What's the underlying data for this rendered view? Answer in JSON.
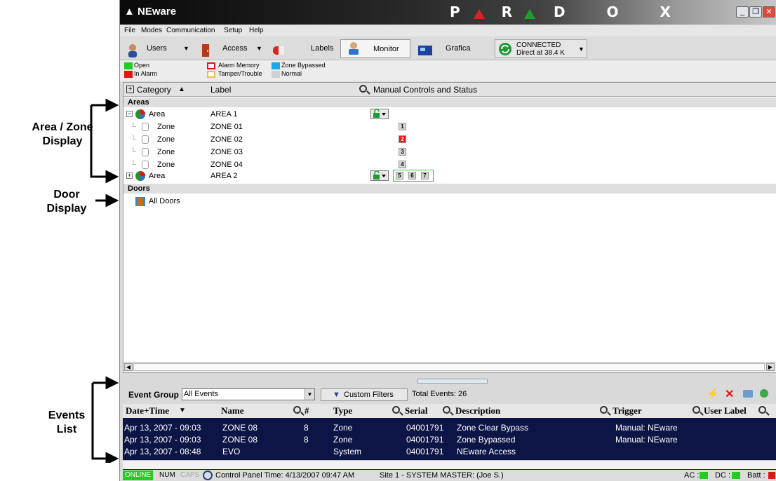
{
  "annotations": {
    "area_zone": [
      "Area / Zone",
      "Display"
    ],
    "door": [
      "Door",
      "Display"
    ],
    "events": [
      "Events",
      "List"
    ]
  },
  "app": {
    "title": "NEware",
    "brand": "PARADOX"
  },
  "menu": [
    "File",
    "Modes",
    "Communication",
    "Setup",
    "Help"
  ],
  "toolbar": {
    "users": "Users",
    "access": "Access",
    "labels": "Labels",
    "monitor": "Monitor",
    "grafica": "Grafica",
    "connection_line1": "CONNECTED",
    "connection_line2": "Direct at 38.4 K"
  },
  "legend": {
    "open": "Open",
    "in_alarm": "In Alarm",
    "alarm_memory": "Alarm Memory",
    "tamper": "Tamper/Trouble",
    "zone_bypassed": "Zone Bypassed",
    "normal": "Normal",
    "colors": {
      "open": "#22cc22",
      "in_alarm": "#e21515",
      "alarm_memory": "#e21515",
      "tamper": "#f0c040",
      "zone_bypassed": "#1aa7e8",
      "normal": "#cfcfcf"
    }
  },
  "grid": {
    "columns": {
      "category": "Category",
      "label": "Label",
      "controls": "Manual Controls and Status"
    },
    "sections": {
      "areas": "Areas",
      "doors": "Doors"
    },
    "area1": {
      "category": "Area",
      "label": "AREA 1"
    },
    "zones": [
      {
        "category": "Zone",
        "label": "ZONE 01",
        "status": "1"
      },
      {
        "category": "Zone",
        "label": "ZONE 02",
        "status": "2"
      },
      {
        "category": "Zone",
        "label": "ZONE 03",
        "status": "3"
      },
      {
        "category": "Zone",
        "label": "ZONE 04",
        "status": "4"
      }
    ],
    "area2": {
      "category": "Area",
      "label": "AREA 2",
      "zones": [
        "5",
        "6",
        "7"
      ]
    },
    "doors_item": "All Doors"
  },
  "events": {
    "group_label": "Event Group",
    "group_value": "All Events",
    "custom_filters": "Custom Filters",
    "total": "Total Events: 26",
    "columns": [
      "Date+Time",
      "Name",
      "#",
      "Type",
      "Serial",
      "Description",
      "Trigger",
      "User Label"
    ],
    "rows": [
      {
        "datetime": "Apr 13, 2007 - 09:03",
        "name": "ZONE 08",
        "num": "8",
        "type": "Zone",
        "serial": "04001791",
        "description": "Zone Clear Bypass",
        "trigger": "Manual: NEware"
      },
      {
        "datetime": "Apr 13, 2007 - 09:03",
        "name": "ZONE 08",
        "num": "8",
        "type": "Zone",
        "serial": "04001791",
        "description": "Zone Bypassed",
        "trigger": "Manual: NEware"
      },
      {
        "datetime": "Apr 13, 2007 - 08:48",
        "name": "EVO",
        "num": "",
        "type": "System",
        "serial": "04001791",
        "description": "NEware Access",
        "trigger": ""
      }
    ]
  },
  "status": {
    "online": "ONLINE",
    "num": "NUM",
    "caps": "CAPS",
    "panel_time": "Control Panel Time: 4/13/2007  09:47 AM",
    "site": "Site 1 - SYSTEM MASTER:  (Joe S.)",
    "ac": "AC :",
    "dc": "DC :",
    "batt": "Batt :"
  }
}
